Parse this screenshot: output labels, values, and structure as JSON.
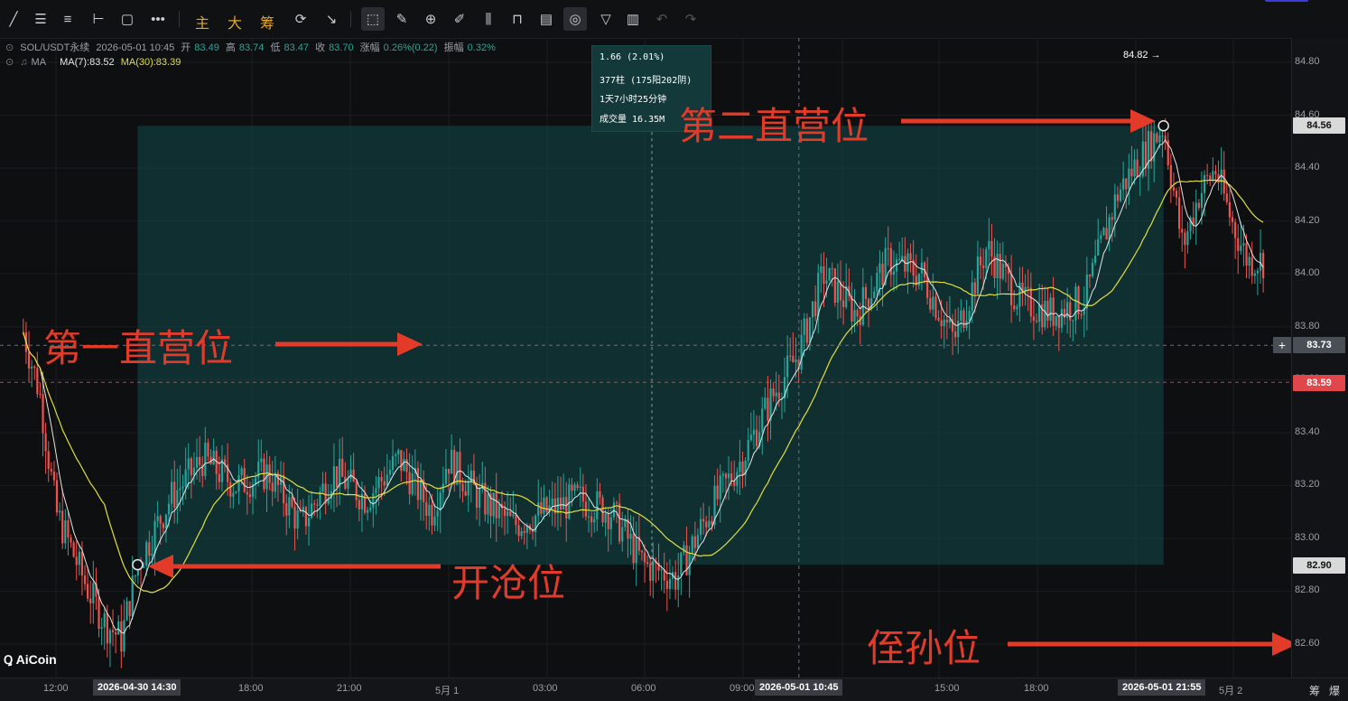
{
  "toolbar": {
    "icons": [
      "line-tool-icon",
      "horizontal-ray-icon",
      "parallel-channel-icon",
      "ray-icon",
      "rectangle-icon",
      "more-icon",
      "cursor-select-icon",
      "ruler-icon",
      "zoom-icon",
      "brush-icon",
      "measure-icon",
      "lock-icon",
      "text-note-icon",
      "magnet-icon",
      "filter-icon",
      "trash-icon",
      "undo-icon",
      "redo-icon"
    ],
    "text_buttons": [
      "主",
      "大",
      "筹"
    ]
  },
  "legend": {
    "symbol": "SOL/USDT永续",
    "datetime": "2026-05-01 10:45",
    "open_label": "开",
    "open": "83.49",
    "high_label": "高",
    "high": "83.74",
    "low_label": "低",
    "low": "83.47",
    "close_label": "收",
    "close": "83.70",
    "change_label": "涨幅",
    "change": "0.26%(0.22)",
    "amplitude_label": "振幅",
    "amplitude": "0.32%",
    "ma_toggle": "MA",
    "ma7": "MA(7):83.52",
    "ma30": "MA(30):83.39"
  },
  "measure_box": {
    "line1": "1.66 (2.01%)",
    "line2": "377柱 (175阳202阴)",
    "line3": "1天7小时25分钟",
    "line4": "成交量 16.35M"
  },
  "annotations": {
    "first": "第一直营位",
    "second": "第二直营位",
    "open": "开沧位",
    "stop": "侄孙位"
  },
  "high_marker": "84.82 →",
  "logo": "AiCoin",
  "price_axis": {
    "ticks": [
      "84.80",
      "84.60",
      "84.40",
      "84.20",
      "84.00",
      "83.80",
      "83.60",
      "83.40",
      "83.20",
      "83.00",
      "82.80",
      "82.60"
    ],
    "tag_top": "84.56",
    "tag_cross": "83.73",
    "tag_current": "83.59",
    "tag_bottom": "82.90"
  },
  "time_axis": {
    "ticks": [
      "12:00",
      "18:00",
      "21:00",
      "5月 1",
      "03:00",
      "06:00",
      "09:00",
      "15:00",
      "18:00",
      "5月 2"
    ],
    "tag_start": "2026-04-30 14:30",
    "tag_cross": "2026-05-01 10:45",
    "tag_end": "2026-05-01 21:55"
  },
  "bottom_right": [
    "筹",
    "爆"
  ],
  "colors": {
    "up": "#26a69a",
    "down": "#ef5350",
    "ma7": "#e6e6e6",
    "ma30": "#e3df3e",
    "range": "#124a4c",
    "annotation": "#e23b2a"
  },
  "chart_data": {
    "type": "candlestick",
    "symbol": "SOL/USDT永续",
    "ylim": [
      82.5,
      84.9
    ],
    "x_range": [
      "2026-04-30 11:00",
      "2026-05-02 01:00"
    ],
    "series": [
      {
        "name": "MA(7)",
        "value": 83.52
      },
      {
        "name": "MA(30)",
        "value": 83.39
      }
    ],
    "measured_range": {
      "start": "2026-04-30 14:30",
      "end": "2026-05-01 21:55",
      "low": 82.9,
      "high": 84.56,
      "change": "1.66 (2.01%)",
      "bars": "377柱 (175阳202阴)",
      "duration": "1天7小时25分钟",
      "volume": "成交量 16.35M"
    },
    "crosshair": {
      "time": "2026-05-01 10:45",
      "price": 83.73
    },
    "current_price": 83.59,
    "high_mark": 84.82,
    "approx_close_path": [
      [
        "2026-04-30 11:00",
        83.78
      ],
      [
        "2026-04-30 11:30",
        83.55
      ],
      [
        "2026-04-30 12:00",
        83.1
      ],
      [
        "2026-04-30 12:30",
        82.95
      ],
      [
        "2026-04-30 13:00",
        82.8
      ],
      [
        "2026-04-30 13:30",
        82.68
      ],
      [
        "2026-04-30 14:00",
        82.62
      ],
      [
        "2026-04-30 14:30",
        82.9
      ],
      [
        "2026-04-30 15:30",
        83.15
      ],
      [
        "2026-04-30 16:30",
        83.3
      ],
      [
        "2026-04-30 17:30",
        83.2
      ],
      [
        "2026-04-30 18:30",
        83.25
      ],
      [
        "2026-04-30 19:30",
        83.05
      ],
      [
        "2026-04-30 20:30",
        83.25
      ],
      [
        "2026-04-30 21:30",
        83.15
      ],
      [
        "2026-04-30 22:30",
        83.3
      ],
      [
        "2026-04-30 23:30",
        83.1
      ],
      [
        "2026-05-01 00:00",
        83.3
      ],
      [
        "2026-05-01 01:00",
        83.15
      ],
      [
        "2026-05-01 02:00",
        83.05
      ],
      [
        "2026-05-01 03:00",
        83.1
      ],
      [
        "2026-05-01 04:00",
        83.15
      ],
      [
        "2026-05-01 05:00",
        83.1
      ],
      [
        "2026-05-01 06:00",
        82.9
      ],
      [
        "2026-05-01 07:00",
        82.85
      ],
      [
        "2026-05-01 08:00",
        83.1
      ],
      [
        "2026-05-01 09:00",
        83.3
      ],
      [
        "2026-05-01 10:00",
        83.55
      ],
      [
        "2026-05-01 10:45",
        83.7
      ],
      [
        "2026-05-01 11:30",
        84.0
      ],
      [
        "2026-05-01 12:30",
        83.85
      ],
      [
        "2026-05-01 13:30",
        84.05
      ],
      [
        "2026-05-01 14:30",
        84.0
      ],
      [
        "2026-05-01 15:30",
        83.75
      ],
      [
        "2026-05-01 16:30",
        84.1
      ],
      [
        "2026-05-01 17:30",
        83.9
      ],
      [
        "2026-05-01 18:30",
        83.85
      ],
      [
        "2026-05-01 19:30",
        83.9
      ],
      [
        "2026-05-01 20:30",
        84.3
      ],
      [
        "2026-05-01 21:00",
        84.4
      ],
      [
        "2026-05-01 21:55",
        84.56
      ],
      [
        "2026-05-01 22:30",
        84.1
      ],
      [
        "2026-05-01 23:00",
        84.3
      ],
      [
        "2026-05-01 23:30",
        84.4
      ],
      [
        "2026-05-02 00:00",
        84.2
      ],
      [
        "2026-05-02 00:30",
        84.05
      ],
      [
        "2026-05-02 01:00",
        84.05
      ]
    ]
  }
}
